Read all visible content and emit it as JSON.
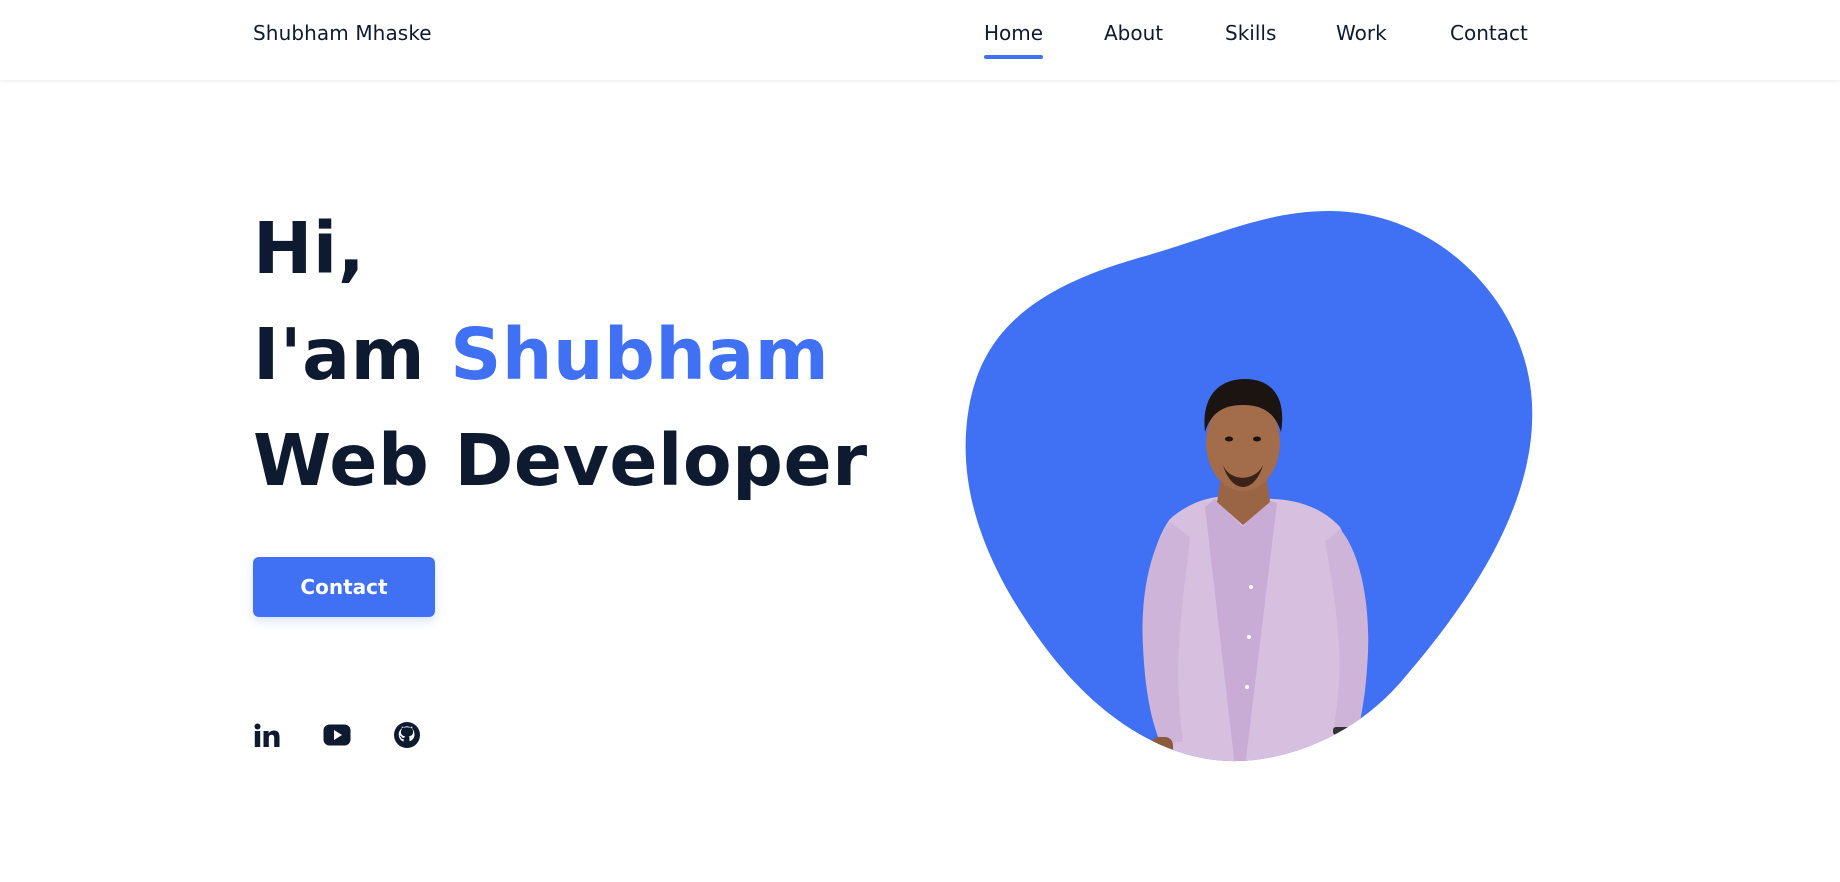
{
  "site": {
    "logo": "Shubham Mhaske"
  },
  "nav": {
    "items": [
      {
        "label": "Home",
        "active": true
      },
      {
        "label": "About",
        "active": false
      },
      {
        "label": "Skills",
        "active": false
      },
      {
        "label": "Work",
        "active": false
      },
      {
        "label": "Contact",
        "active": false
      }
    ]
  },
  "hero": {
    "greeting": "Hi,",
    "intro_prefix": "I'am",
    "name": "Shubham",
    "role": "Web Developer",
    "button_label": "Contact"
  },
  "social": [
    {
      "name": "linkedin",
      "icon": "linkedin-icon"
    },
    {
      "name": "youtube",
      "icon": "youtube-icon"
    },
    {
      "name": "github",
      "icon": "github-icon"
    }
  ],
  "colors": {
    "accent": "#4070f4",
    "text": "#0e1a2f",
    "background": "#ffffff"
  }
}
